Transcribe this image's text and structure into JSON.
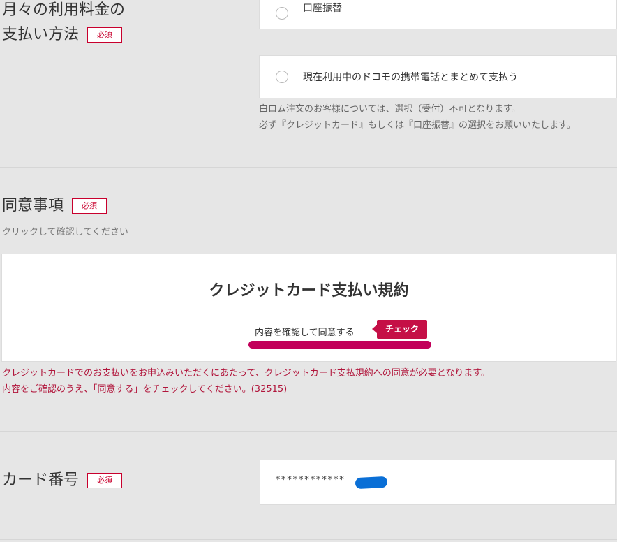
{
  "payment": {
    "title_line1": "月々の利用料金の",
    "title_line2": "支払い方法",
    "required": "必須",
    "options": [
      "口座振替",
      "現在利用中のドコモの携帯電話とまとめて支払う"
    ],
    "note_line1": "白ロム注文のお客様については、選択（受付）不可となります。",
    "note_line2": "必ず『クレジットカード』もしくは『口座振替』の選択をお願いいたします。"
  },
  "consent": {
    "title": "同意事項",
    "required": "必須",
    "hint": "クリックして確認してください",
    "card_title": "クレジットカード支払い規約",
    "agree_label": "内容を確認して同意する",
    "check_tag": "チェック",
    "warning_line1": "クレジットカードでのお支払いをお申込みいただくにあたって、クレジットカード支払規約への同意が必要となります。",
    "warning_line2": "内容をご確認のうえ、「同意する」をチェックしてください。(32515)"
  },
  "card_number": {
    "label": "カード番号",
    "required": "必須",
    "value": "************"
  },
  "colors": {
    "accent": "#c8002d",
    "underline": "#c2005a",
    "redaction": "#0a6fd6"
  }
}
